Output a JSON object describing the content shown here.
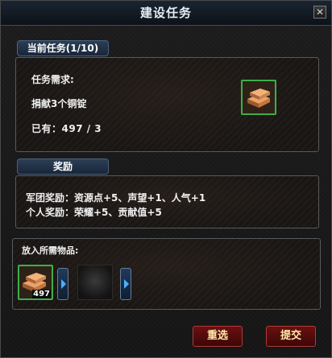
{
  "window": {
    "title": "建设任务",
    "close_glyph": "✕"
  },
  "task": {
    "header": "当前任务(1/10)",
    "requirement_label": "任务需求:",
    "requirement_text": "捐献3个铜锭",
    "owned_text": "已有：497 / 3",
    "item_icon": "copper-ingot-icon"
  },
  "reward": {
    "header": "奖励",
    "legion_reward": "军团奖励：资源点+5、声望+1、人气+1",
    "personal_reward": "个人奖励：荣耀+5、贡献值+5"
  },
  "submit_area": {
    "label": "放入所需物品:",
    "slot_item_icon": "copper-ingot-icon",
    "slot_item_count": "497",
    "empty_slot_icon": "empty-slot-icon"
  },
  "buttons": {
    "reset": "重选",
    "submit": "提交"
  },
  "colors": {
    "button_red": "#6a1010",
    "slot_border_green": "#3fae4a",
    "tag_blue": "#2c3e55"
  }
}
